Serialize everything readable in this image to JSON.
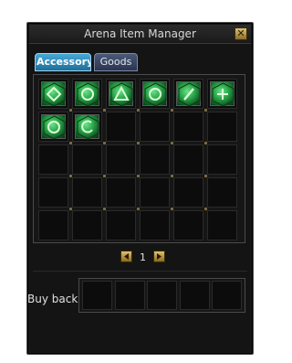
{
  "window": {
    "title": "Arena Item Manager",
    "close_icon": "close-x-icon"
  },
  "tabs": [
    {
      "label": "Accessory",
      "active": true
    },
    {
      "label": "Goods",
      "active": false
    }
  ],
  "grid": {
    "rows": 5,
    "cols": 6,
    "items": [
      {
        "name": "green-gem-item",
        "glyph": "diamond"
      },
      {
        "name": "green-gem-item",
        "glyph": "ring"
      },
      {
        "name": "green-gem-item",
        "glyph": "triangle"
      },
      {
        "name": "green-gem-item",
        "glyph": "ring"
      },
      {
        "name": "green-gem-item",
        "glyph": "slash"
      },
      {
        "name": "green-gem-item",
        "glyph": "plus"
      },
      {
        "name": "green-gem-item",
        "glyph": "ring"
      },
      {
        "name": "green-gem-item",
        "glyph": "hook"
      }
    ]
  },
  "pager": {
    "page": "1",
    "prev_icon": "arrow-left-icon",
    "next_icon": "arrow-right-icon"
  },
  "buyback": {
    "label": "Buy back",
    "slots": 5
  },
  "colors": {
    "window_bg": "#141414",
    "active_tab": "#2f8fc4",
    "inactive_tab": "#3a4664",
    "gem_green": "#2aa64a",
    "gold_button": "#c8a048"
  }
}
